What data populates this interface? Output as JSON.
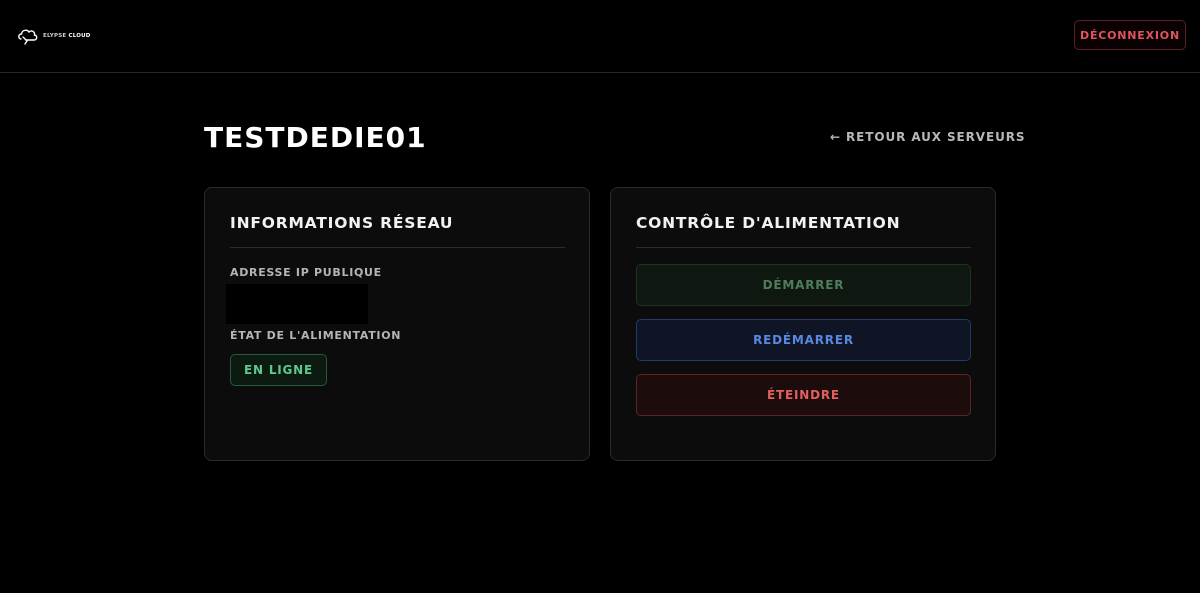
{
  "header": {
    "logo_text_light": "ELYPSE",
    "logo_text_bold": "CLOUD",
    "logout_label": "DÉCONNEXION"
  },
  "page": {
    "title": "TESTDEDIE01",
    "back_label": "← RETOUR AUX SERVEURS"
  },
  "network_card": {
    "title": "INFORMATIONS RÉSEAU",
    "ip_label": "ADRESSE IP PUBLIQUE",
    "ip_value": "",
    "power_state_label": "ÉTAT DE L'ALIMENTATION",
    "power_state_value": "EN LIGNE"
  },
  "power_card": {
    "title": "CONTRÔLE D'ALIMENTATION",
    "start_label": "DÉMARRER",
    "restart_label": "REDÉMARRER",
    "stop_label": "ÉTEINDRE"
  },
  "colors": {
    "background": "#000000",
    "danger": "#e0545c",
    "success": "#5fc88a",
    "info": "#5a87e0"
  },
  "icons": {
    "logo": "cloud-logo-icon"
  }
}
